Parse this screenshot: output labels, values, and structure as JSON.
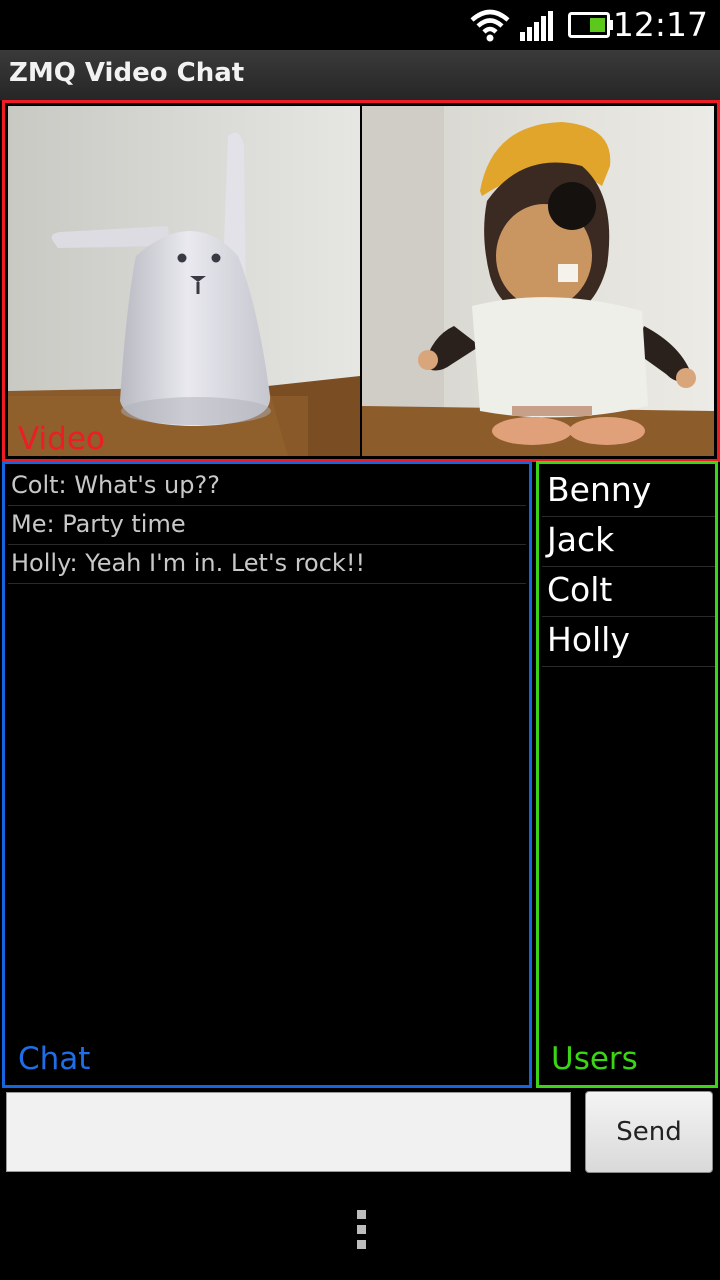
{
  "status_bar": {
    "time": "12:17",
    "icons": [
      "wifi-icon",
      "signal-icon",
      "battery-icon"
    ],
    "battery_color": "#5cc81c"
  },
  "app": {
    "title": "ZMQ Video Chat"
  },
  "video_panel": {
    "label": "Video",
    "color": "#ee1c25",
    "feeds": [
      "rabbit-lamp-feed",
      "mole-plush-feed"
    ]
  },
  "chat_panel": {
    "label": "Chat",
    "color": "#1565e0",
    "messages": [
      "Colt: What's up??",
      "Me: Party time",
      "Holly: Yeah I'm in. Let's rock!!"
    ]
  },
  "users_panel": {
    "label": "Users",
    "color": "#3cd417",
    "users": [
      "Benny",
      "Jack",
      "Colt",
      "Holly"
    ]
  },
  "composer": {
    "input_value": "",
    "send_label": "Send"
  },
  "menu": {
    "icon": "overflow-menu-icon"
  }
}
